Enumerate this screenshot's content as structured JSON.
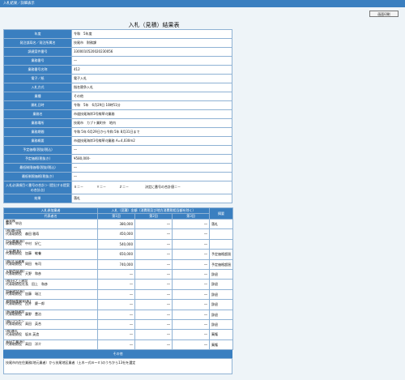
{
  "topbar": {
    "title": "入札結果／詳細表示"
  },
  "print_button": "画面印刷",
  "page_title": "入札（見積）結果表",
  "info": [
    {
      "label": "年度",
      "value": "令和　5年度"
    },
    {
      "label": "発注部局名／発注所属名",
      "value": "技尾市　財務課"
    },
    {
      "label": "調達案件番号",
      "value": "3300010520020230056"
    },
    {
      "label": "業務番号",
      "value": "―"
    },
    {
      "label": "業務番号名称",
      "value": "412"
    },
    {
      "label": "電子／紙",
      "value": "電子入札"
    },
    {
      "label": "入札方式",
      "value": "指名競争入札"
    },
    {
      "label": "業種",
      "value": "その他"
    },
    {
      "label": "開札日時",
      "value": "令和　5年　6月29日 10時51分"
    },
    {
      "label": "業務名",
      "value": "市道技尾海岸3号線草刈業務"
    },
    {
      "label": "業務場所",
      "value": "技尾市　カブト業町外　地内"
    },
    {
      "label": "業務期間",
      "value": "令和 5年 6月29日から令和 5年 8月31日まで"
    },
    {
      "label": "業務概要",
      "value": "市道技尾海岸3号線草刈業務 A=4,030m2"
    },
    {
      "label": "予定価格(税抜/税込)",
      "value": "―"
    },
    {
      "label": "予定価格(税抜き)",
      "value": "¥580,000-"
    },
    {
      "label": "最低制限価格(税抜/税込)",
      "value": "―"
    },
    {
      "label": "最低制限価格(税抜き)",
      "value": "―"
    },
    {
      "label": "入札必須項目＜番号の合計＞ (提出する提案の合計点)",
      "value": "Ｘ＝－　　　　Ｙ＝－　　　　Ｚ＝－　　　　　決定に番号の合計値＝－"
    },
    {
      "label": "結果",
      "value": "落札"
    }
  ],
  "bidders": {
    "headers": {
      "company": "入札参加業者",
      "amount_group": "入札（見積）金額（消費税及び地方消費税相当額を除く）",
      "rep": "代表者名",
      "round1": "第1回",
      "round2": "第2回",
      "round3": "第3回",
      "remarks": "摘要"
    },
    "rows": [
      {
        "name": "藤米株",
        "rep": "藤米　申治",
        "r1": "380,000",
        "r2": "―",
        "r3": "―",
        "remark": "落札"
      },
      {
        "name": "(株)森田組",
        "rep": "代表取締役　森田 雅寿",
        "r1": "450,000",
        "r2": "―",
        "r3": "―",
        "remark": ""
      },
      {
        "name": "白石農業(有)",
        "rep": "代表取締役　中村　好仁",
        "r1": "540,000",
        "r2": "―",
        "r3": "―",
        "remark": ""
      },
      {
        "name": "上岩瀬(有)",
        "rep": "代表取締役　加藤　敏養",
        "r1": "650,000",
        "r2": "―",
        "r3": "―",
        "remark": "予定価格超過"
      },
      {
        "name": "(株)大深建業",
        "rep": "代表取締役　岡田　有司",
        "r1": "740,000",
        "r2": "―",
        "r3": "―",
        "remark": "予定価格超過"
      },
      {
        "name": "天野造園(株)",
        "rep": "代表取締役　天野　和彦",
        "r1": "―",
        "r2": "―",
        "r3": "―",
        "remark": "辞退"
      },
      {
        "name": "(株)田之上建設",
        "rep": "代表取締役社長　田上　和彦",
        "r1": "―",
        "r2": "―",
        "r3": "―",
        "remark": "辞退"
      },
      {
        "name": "加藤建設(有)",
        "rep": "代表取締役　加藤　瑞江",
        "r1": "―",
        "r2": "―",
        "r3": "―",
        "remark": "辞退"
      },
      {
        "name": "湘南緑産開発(有)",
        "rep": "代表取締役　西井　慶一郎",
        "r1": "―",
        "r2": "―",
        "r3": "―",
        "remark": "辞退"
      },
      {
        "name": "(有)藤野建設",
        "rep": "代表取締役　藤野　豊治",
        "r1": "―",
        "r2": "―",
        "r3": "―",
        "remark": "辞退"
      },
      {
        "name": "(株)コウケン",
        "rep": "代表取締役　高田　英合",
        "r1": "―",
        "r2": "―",
        "r3": "―",
        "remark": "辞退"
      },
      {
        "name": "(株)森丸",
        "rep": "代表取締役　坂本 英造",
        "r1": "―",
        "r2": "―",
        "r3": "―",
        "remark": "棄権"
      },
      {
        "name": "高田工業(有)",
        "rep": "代表取締役　高田　洋介",
        "r1": "―",
        "r2": "―",
        "r3": "―",
        "remark": "棄権"
      }
    ]
  },
  "other": {
    "header": "その他",
    "text": "技尾市内在住業務(地元業者）から技尾地区業者（土木一式Ｂ～Ｅ)のうちから13社を選定"
  }
}
